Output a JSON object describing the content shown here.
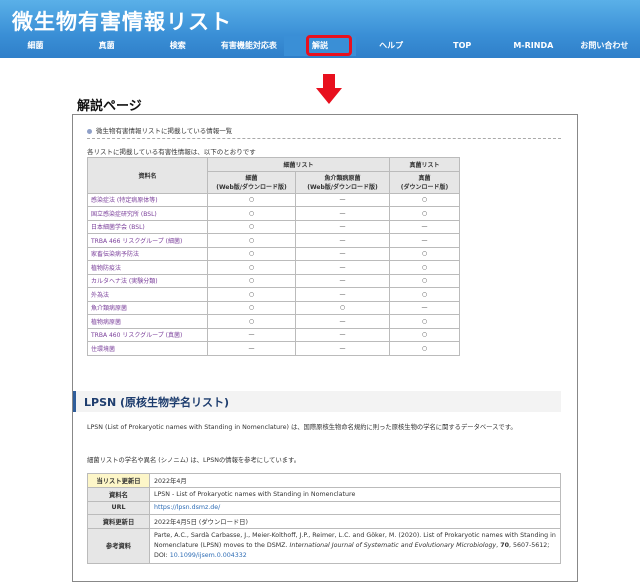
{
  "site": {
    "title": "微生物有害情報リスト"
  },
  "nav": {
    "items": [
      {
        "label": "細菌",
        "id": "bacteria"
      },
      {
        "label": "真菌",
        "id": "fungi"
      },
      {
        "label": "検索",
        "id": "search"
      },
      {
        "label": "有害機能対応表",
        "id": "harm-table"
      },
      {
        "label": "解説",
        "id": "commentary"
      },
      {
        "label": "ヘルプ",
        "id": "help"
      },
      {
        "label": "TOP",
        "id": "top"
      },
      {
        "label": "M-RINDA",
        "id": "m-rinda"
      },
      {
        "label": "お問い合わせ",
        "id": "contact"
      }
    ],
    "active_index": 4,
    "highlight_color": "#e8101e",
    "bar_color": "#3a8fd6"
  },
  "page_label": "解説ページ",
  "section": {
    "title": "微生物有害情報リストに掲載している情報一覧",
    "intro": "各リストに掲載している有害性情報は、以下のとおりです"
  },
  "harm_table": {
    "header_name": "資料名",
    "group_bacteria": "細菌リスト",
    "group_fungi": "真菌リスト",
    "col_bacteria": "細菌\n(Web版/ダウンロード版)",
    "col_fish": "魚介類病原菌\n(Web版/ダウンロード版)",
    "col_fungi": "真菌\n(ダウンロード版)",
    "rows": [
      {
        "name": "感染症法 (特定病原体等)",
        "bacteria": "○",
        "fish": "—",
        "fungi": "○"
      },
      {
        "name": "国立感染症研究所 (BSL)",
        "bacteria": "○",
        "fish": "—",
        "fungi": "○"
      },
      {
        "name": "日本細菌学会 (BSL)",
        "bacteria": "○",
        "fish": "—",
        "fungi": "—"
      },
      {
        "name": "TRBA 466 リスクグループ (細菌)",
        "bacteria": "○",
        "fish": "—",
        "fungi": "—"
      },
      {
        "name": "家畜伝染病予防法",
        "bacteria": "○",
        "fish": "—",
        "fungi": "○"
      },
      {
        "name": "植物防疫法",
        "bacteria": "○",
        "fish": "—",
        "fungi": "○"
      },
      {
        "name": "カルタヘナ法 (実験分類)",
        "bacteria": "○",
        "fish": "—",
        "fungi": "○"
      },
      {
        "name": "外為法",
        "bacteria": "○",
        "fish": "—",
        "fungi": "○"
      },
      {
        "name": "魚介類病原菌",
        "bacteria": "○",
        "fish": "○",
        "fungi": "—"
      },
      {
        "name": "植物病原菌",
        "bacteria": "○",
        "fish": "—",
        "fungi": "○"
      },
      {
        "name": "TRBA 460 リスクグループ (真菌)",
        "bacteria": "—",
        "fish": "—",
        "fungi": "○"
      },
      {
        "name": "住環境菌",
        "bacteria": "—",
        "fish": "—",
        "fungi": "○"
      }
    ]
  },
  "lpsn": {
    "heading": "LPSN (原核生物学名リスト)",
    "desc": "LPSN (List of Prokaryotic names with Standing in Nomenclature) は、国際原核生物命名規約に則った原核生物の学名に関するデータベースです。",
    "note": "細菌リストの学名や異名 (シノニム) は、LPSNの情報を参考にしています。",
    "info": {
      "updated_label": "当リスト更新日",
      "updated_value": "2022年4月",
      "source_label": "資料名",
      "source_value": "LPSN - List of Prokaryotic names with Standing in Nomenclature",
      "url_label": "URL",
      "url_value": "https://lpsn.dsmz.de/",
      "source_updated_label": "資料更新日",
      "source_updated_value": "2022年4月5日 (ダウンロード日)",
      "ref_label": "参考資料",
      "ref_authors": "Parte, A.C., Sardà Carbasse, J., Meier-Kolthoff, J.P., Reimer, L.C. and Göker, M. (2020). List of Prokaryotic names with Standing in Nomenclature (LPSN) moves to the DSMZ.",
      "ref_journal": "International Journal of Systematic and Evolutionary Microbiology",
      "ref_volume": "70",
      "ref_pages": ", 5607-5612; DOI: ",
      "ref_doi": "10.1099/ijsem.0.004332"
    }
  }
}
